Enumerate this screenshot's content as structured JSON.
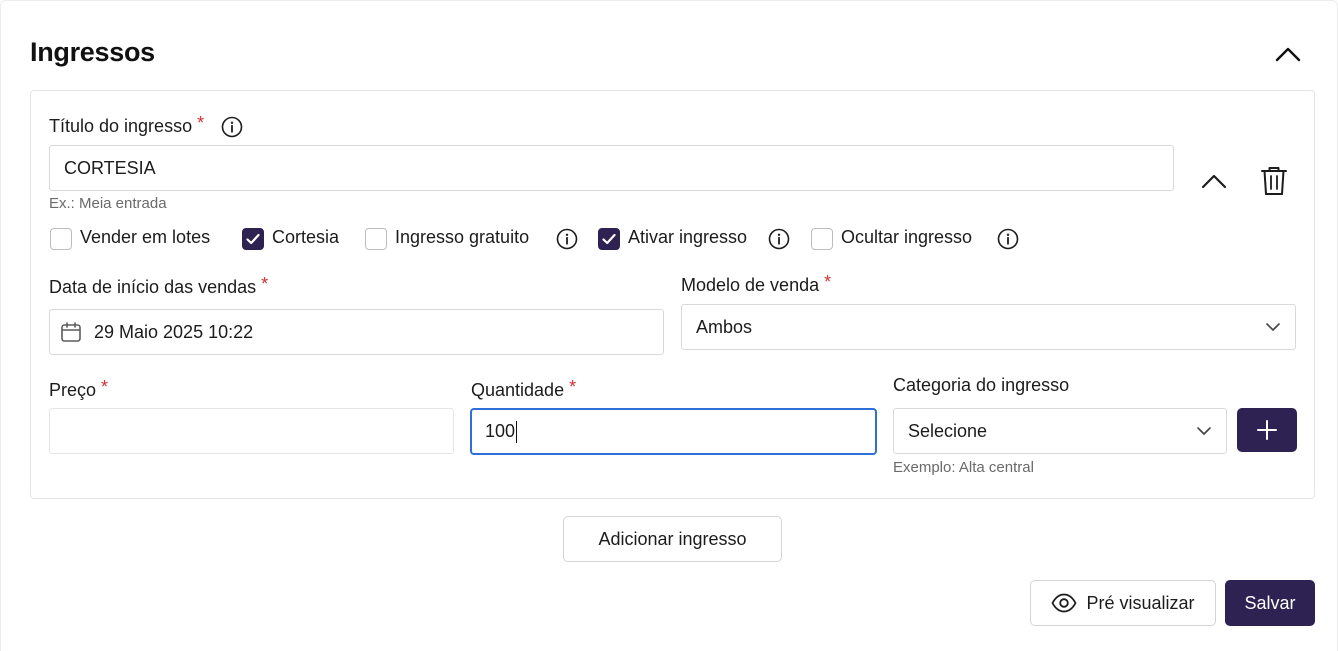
{
  "section": {
    "title": "Ingressos",
    "collapse_icon": "chevron-up-icon"
  },
  "ticket": {
    "title_label": "Título do ingresso",
    "title_value": "CORTESIA",
    "title_helper": "Ex.: Meia entrada",
    "checkboxes": [
      {
        "label": "Vender em lotes",
        "checked": false,
        "info": false
      },
      {
        "label": "Cortesia",
        "checked": true,
        "info": false
      },
      {
        "label": "Ingresso gratuito",
        "checked": false,
        "info": true
      },
      {
        "label": "Ativar ingresso",
        "checked": true,
        "info": true
      },
      {
        "label": "Ocultar ingresso",
        "checked": false,
        "info": true
      }
    ],
    "start_date_label": "Data de início das vendas",
    "start_date_value": "29 Maio 2025 10:22",
    "sale_model_label": "Modelo de venda",
    "sale_model_value": "Ambos",
    "price_label": "Preço",
    "price_value": "",
    "quantity_label": "Quantidade",
    "quantity_value": "100",
    "category_label": "Categoria do ingresso",
    "category_value": "Selecione",
    "category_helper": "Exemplo: Alta central",
    "required_mark": "*"
  },
  "actions": {
    "add_ticket": "Adicionar ingresso",
    "preview": "Pré visualizar",
    "save": "Salvar"
  },
  "colors": {
    "brand": "#2d2252",
    "required": "#d32f2f",
    "focus": "#2f6fd8"
  }
}
